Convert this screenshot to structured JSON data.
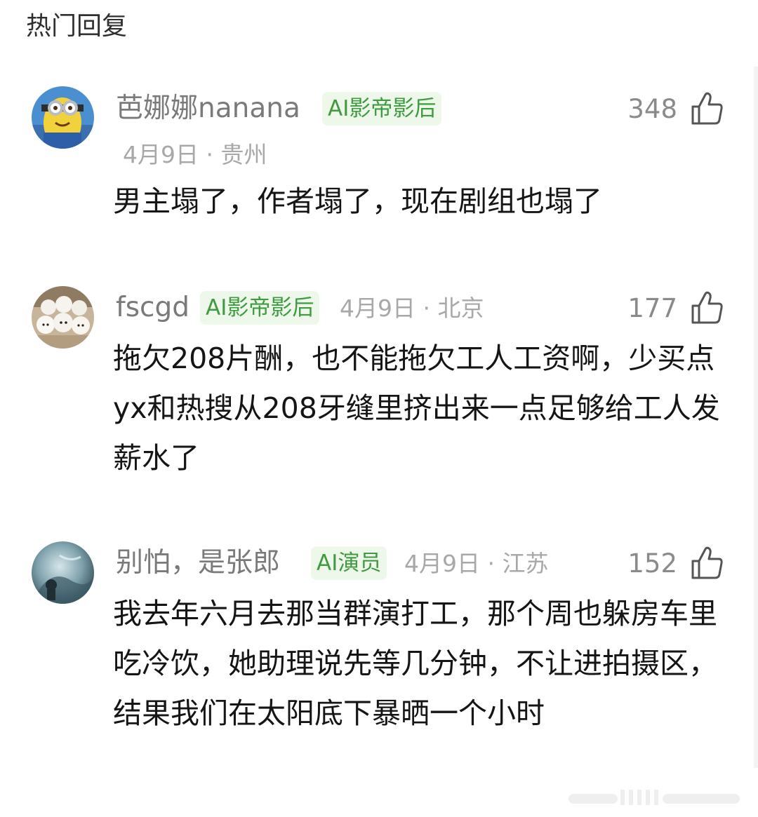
{
  "header": {
    "title": "热门回复"
  },
  "comments": [
    {
      "username": "芭娜娜nanana",
      "badge": "AI影帝影后",
      "date_location": "4月9日 · 贵州",
      "likes": "348",
      "text": "男主塌了，作者塌了，现在剧组也塌了"
    },
    {
      "username": "fscgd",
      "badge": "AI影帝影后",
      "date_location": "4月9日 · 北京",
      "likes": "177",
      "text": "拖欠208片酬，也不能拖欠工人工资啊，少买点yx和热搜从208牙缝里挤出来一点足够给工人发薪水了"
    },
    {
      "username": "别怕，是张郎",
      "badge": "AI演员",
      "date_location": "4月9日 · 江苏",
      "likes": "152",
      "text": "我去年六月去那当群演打工，那个周也躲房车里吃冷饮，她助理说先等几分钟，不让进拍摄区，结果我们在太阳底下暴晒一个小时"
    }
  ],
  "icons": {
    "like": "thumbs-up-icon"
  },
  "colors": {
    "badge_text": "#3f9b3f",
    "badge_bg": "#eef8ea",
    "username": "#7a7a7a",
    "meta": "#a8a8a8"
  }
}
